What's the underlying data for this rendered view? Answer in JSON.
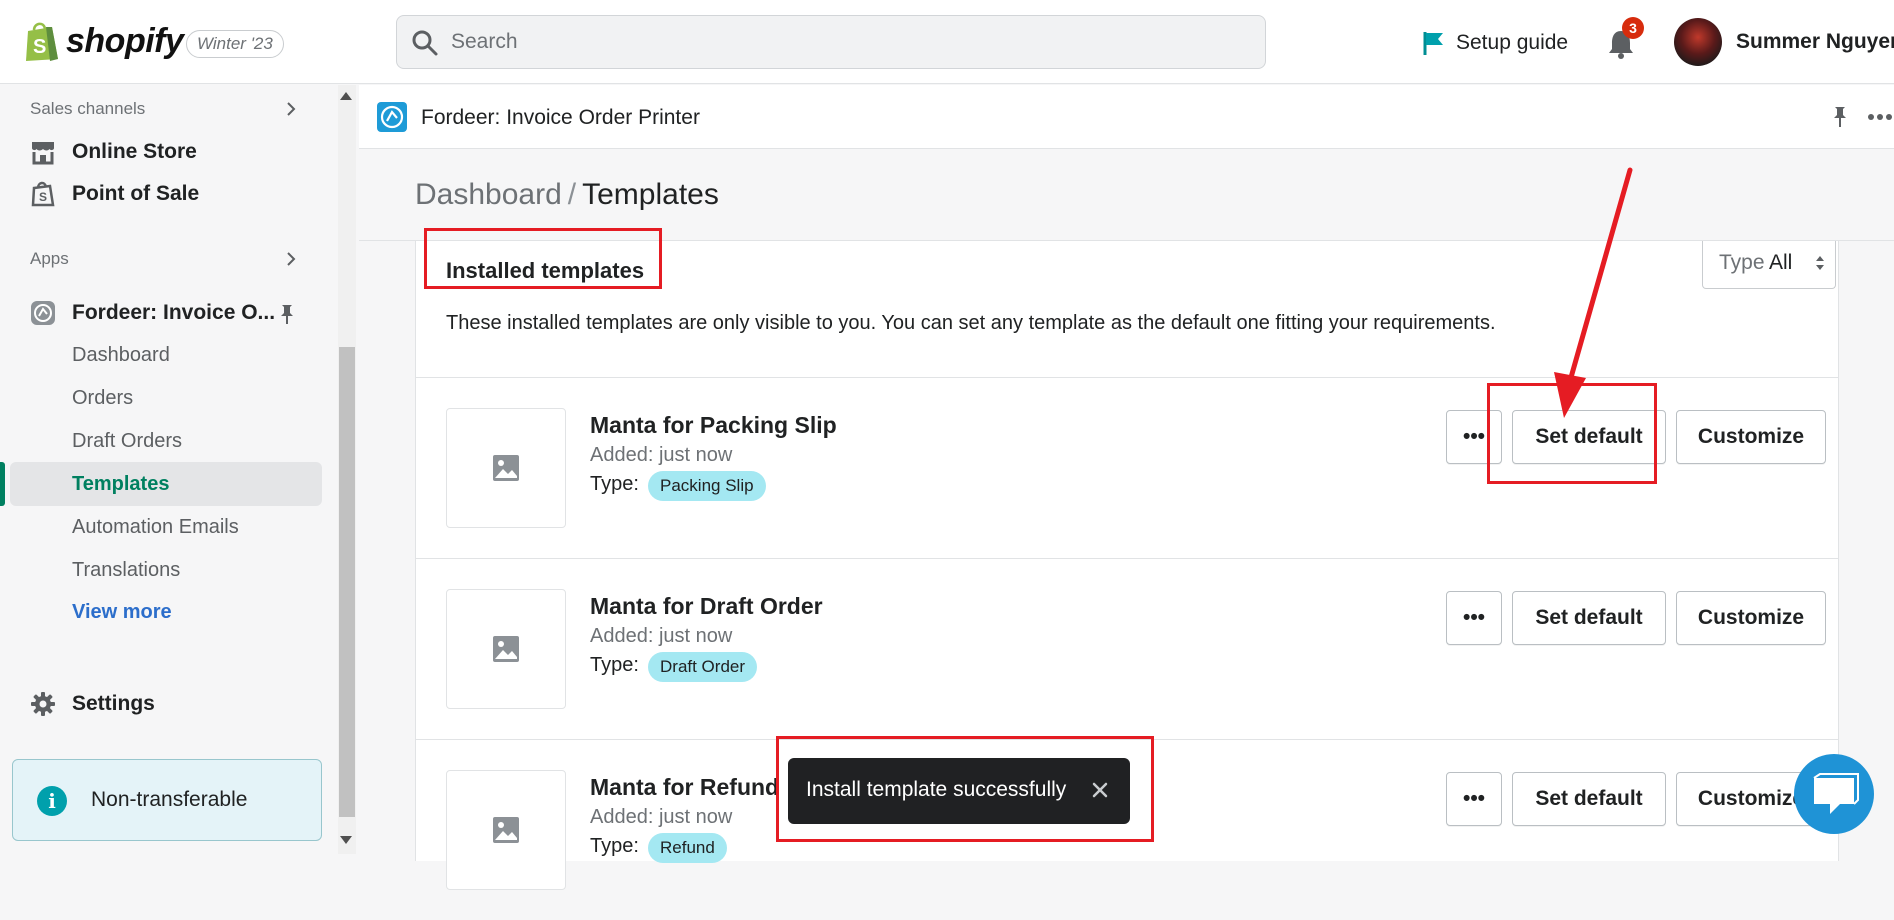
{
  "topbar": {
    "brand": "shopify",
    "version": "Winter '23",
    "search_placeholder": "Search",
    "setup_guide": "Setup guide",
    "notifications_count": "3",
    "user_name": "Summer Nguyen"
  },
  "sidebar": {
    "sales_channels_label": "Sales channels",
    "online_store": "Online Store",
    "point_of_sale": "Point of Sale",
    "apps_label": "Apps",
    "app_name": "Fordeer: Invoice O...",
    "sub_items": [
      "Dashboard",
      "Orders",
      "Draft Orders",
      "Templates",
      "Automation Emails",
      "Translations",
      "View more"
    ],
    "active_item": "Templates",
    "settings": "Settings",
    "non_transferable": "Non-transferable"
  },
  "app": {
    "title": "Fordeer: Invoice Order Printer",
    "breadcrumb_parent": "Dashboard",
    "breadcrumb_sep": "/",
    "breadcrumb_current": "Templates",
    "card_title": "Installed templates",
    "type_label": "Type",
    "type_value": "All",
    "description": "These installed templates are only visible to you. You can set any template as the default one fitting your requirements.",
    "type_prefix": "Type:",
    "more_button": "•••",
    "set_default_label": "Set default",
    "customize_label": "Customize",
    "templates": [
      {
        "name": "Manta for Packing Slip",
        "added": "Added: just now",
        "type": "Packing Slip"
      },
      {
        "name": "Manta for Draft Order",
        "added": "Added: just now",
        "type": "Draft Order"
      },
      {
        "name": "Manta for Refund",
        "added": "Added: just now",
        "type": "Refund"
      }
    ]
  },
  "toast": {
    "message": "Install template successfully"
  },
  "colors": {
    "accent_green": "#008060",
    "link_blue": "#2c6ecb",
    "badge_cyan": "#a4e8f2",
    "annotation_red": "#e51c23",
    "notification_red": "#d72c0d"
  }
}
